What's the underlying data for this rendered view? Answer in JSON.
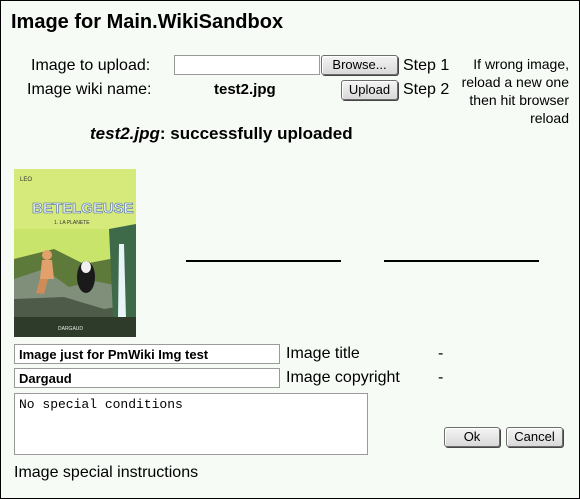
{
  "title": "Image for Main.WikiSandbox",
  "upload": {
    "image_to_upload_label": "Image to upload:",
    "file_value": "",
    "browse_label": "Browse...",
    "step1_label": "Step 1",
    "wiki_name_label": "Image wiki name:",
    "wiki_name_value": "test2.jpg",
    "upload_label": "Upload",
    "step2_label": "Step 2",
    "note": "If wrong image, reload a new one then hit browser reload"
  },
  "status": {
    "filename": "test2.jpg",
    "message": ": successfully uploaded"
  },
  "cover": {
    "author": "LEO",
    "series": "BETELGEUSE",
    "volume": "1. LA PLANETE",
    "publisher": "DARGAUD"
  },
  "fields": {
    "image_title_value": "Image just for PmWiki Img test",
    "image_title_label": "Image title",
    "image_title_dash": "-",
    "copyright_value": "Dargaud",
    "copyright_label": "Image copyright",
    "copyright_dash": "-",
    "special_conditions_value": "No special conditions",
    "special_instructions_label": "Image special instructions"
  },
  "buttons": {
    "ok_label": "Ok",
    "cancel_label": "Cancel"
  },
  "colors": {
    "background": "#f6fbf6",
    "cover_sky": "#c8e46a",
    "cover_title": "#e8f0f8"
  }
}
